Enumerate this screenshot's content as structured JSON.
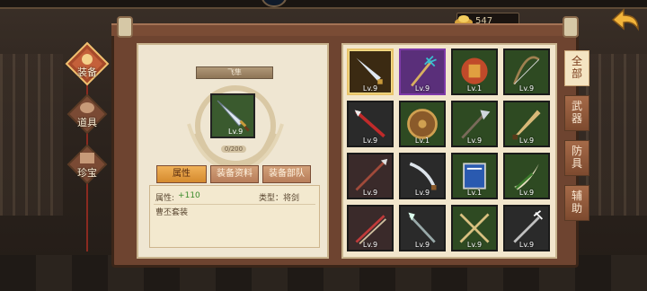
{
  "currency": {
    "amount": "547",
    "icon": "gold-ingot-icon"
  },
  "sidebar": {
    "items": [
      {
        "label": "装备",
        "active": true
      },
      {
        "label": "道具",
        "active": false
      },
      {
        "label": "珍宝",
        "active": false
      }
    ]
  },
  "detail": {
    "name": "飞隼",
    "level": "Lv.9",
    "progress_text": "0/200",
    "progress_value": 0,
    "tabs": [
      "属性",
      "装备资料",
      "装备部队"
    ],
    "attr_label": "属性:",
    "attr_value": "+110",
    "type_text": "类型：将剑",
    "set_text": "曹丕套装"
  },
  "inventory": {
    "items": [
      {
        "level": "Lv.9",
        "icon": "sword-icon",
        "bg": "#3b2a12",
        "selected": true
      },
      {
        "level": "Lv.9",
        "icon": "trident-icon",
        "bg": "#5a2f7a",
        "purple": true
      },
      {
        "level": "Lv.1",
        "icon": "mask-shield-icon",
        "bg": "#2e4a22"
      },
      {
        "level": "Lv.9",
        "icon": "bow-icon",
        "bg": "#2e4a22"
      },
      {
        "level": "Lv.9",
        "icon": "red-spear-icon",
        "bg": "#2a2a2a"
      },
      {
        "level": "Lv.1",
        "icon": "round-shield-icon",
        "bg": "#2e4a22"
      },
      {
        "level": "Lv.9",
        "icon": "halberd-icon",
        "bg": "#2e4a22"
      },
      {
        "level": "Lv.9",
        "icon": "broadsword-icon",
        "bg": "#2e4a22"
      },
      {
        "level": "Lv.9",
        "icon": "spear-icon",
        "bg": "#3a2a2a"
      },
      {
        "level": "Lv.9",
        "icon": "saber-icon",
        "bg": "#2a2a2a"
      },
      {
        "level": "Lv.1",
        "icon": "blue-shield-icon",
        "bg": "#2e4a22"
      },
      {
        "level": "Lv.9",
        "icon": "crescent-blade-icon",
        "bg": "#2e4a22"
      },
      {
        "level": "Lv.9",
        "icon": "twin-spear-icon",
        "bg": "#3a2a2a"
      },
      {
        "level": "Lv.9",
        "icon": "axe-spear-icon",
        "bg": "#2a2a2a"
      },
      {
        "level": "Lv.9",
        "icon": "crossed-blades-icon",
        "bg": "#2e4a22"
      },
      {
        "level": "Lv.9",
        "icon": "trident-spear-icon",
        "bg": "#2a2a2a"
      }
    ]
  },
  "categories": [
    "全部",
    "武器",
    "防具",
    "辅助"
  ]
}
